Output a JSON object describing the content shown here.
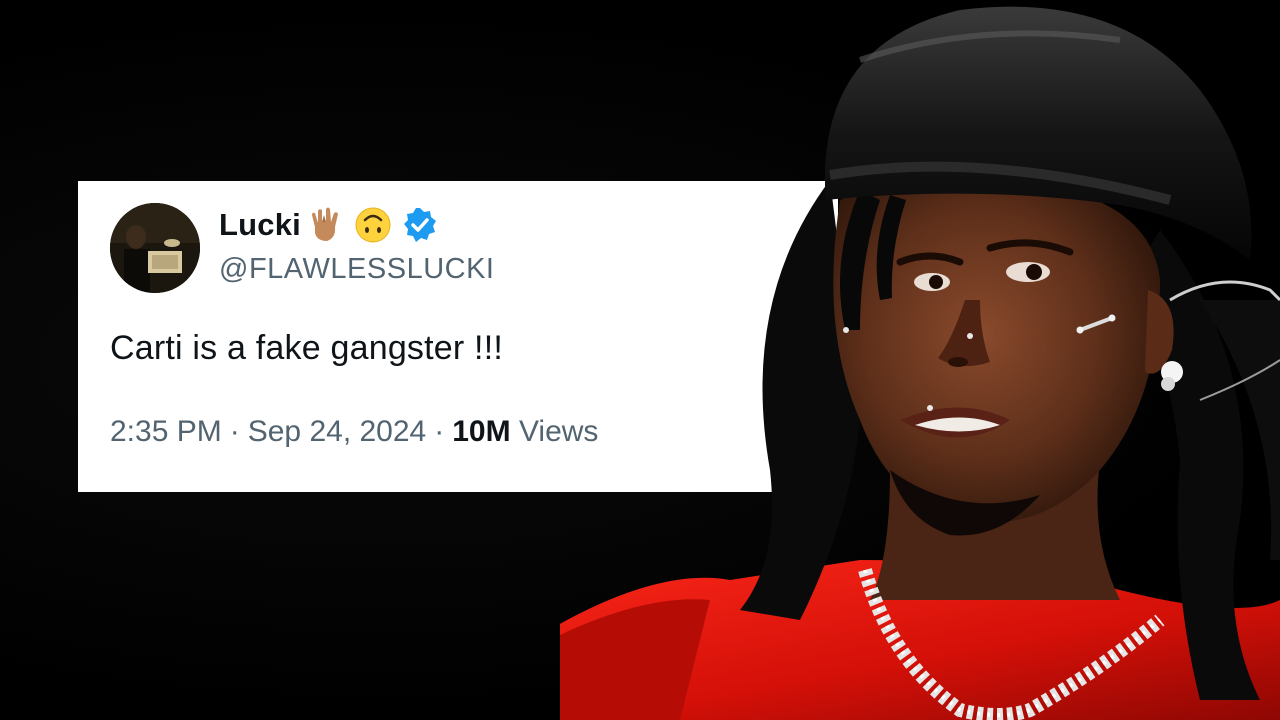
{
  "tweet": {
    "display_name": "Lucki",
    "name_emojis": [
      "vulcan-salute-emoji",
      "upside-down-face-emoji"
    ],
    "verified_badge": "verified-badge-icon",
    "handle": "@FLAWLESSLUCKI",
    "text": "Carti is a fake gangster !!!",
    "time": "2:35 PM",
    "separator": "·",
    "date": "Sep 24, 2024",
    "views_count": "10M",
    "views_label": "Views"
  },
  "colors": {
    "background": "#000000",
    "card": "#ffffff",
    "primary_text": "#0f1419",
    "secondary_text": "#536471",
    "verified_blue": "#1d9bf0",
    "shirt_red": "#e3140f"
  },
  "photo": {
    "subject": "person-photo"
  }
}
